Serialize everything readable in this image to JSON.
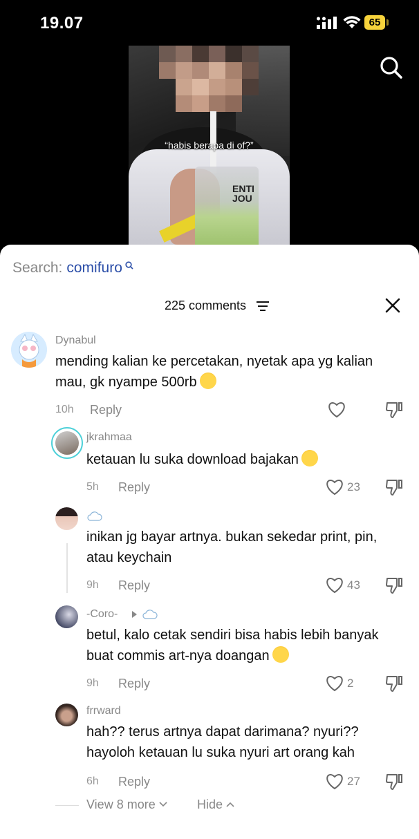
{
  "status_bar": {
    "time": "19.07",
    "battery": "65"
  },
  "video": {
    "caption": "“habis berapa di of?”",
    "cup_text": "ENTI\nJOU"
  },
  "search": {
    "label": "Search:",
    "term": "comifuro"
  },
  "comments_header": {
    "count_label": "225 comments"
  },
  "comments": [
    {
      "username": "Dynabul",
      "text": "mending kalian ke percetakan, nyetak apa yg kalian mau, gk nyampe 500rb",
      "time": "10h",
      "reply": "Reply",
      "likes": ""
    },
    {
      "username": "jkrahmaa",
      "text": "ketauan lu suka download bajakan",
      "time": "5h",
      "reply": "Reply",
      "likes": "23"
    },
    {
      "username": "",
      "text": "inikan jg bayar artnya. bukan sekedar print, pin, atau keychain",
      "time": "9h",
      "reply": "Reply",
      "likes": "43"
    },
    {
      "username": "-Coro-",
      "text": "betul, kalo cetak sendiri bisa habis lebih banyak buat commis art-nya doangan",
      "time": "9h",
      "reply": "Reply",
      "likes": "2"
    },
    {
      "username": "frrward",
      "text": "hah?? terus artnya dapat darimana? nyuri?? hayoloh ketauan lu suka nyuri art orang kah",
      "time": "6h",
      "reply": "Reply",
      "likes": "27"
    }
  ],
  "thread_controls": {
    "view_more": "View 8 more",
    "hide": "Hide"
  },
  "colors": {
    "accent_link": "#2b4ea8",
    "battery": "#f7d33b",
    "muted": "#888888"
  }
}
